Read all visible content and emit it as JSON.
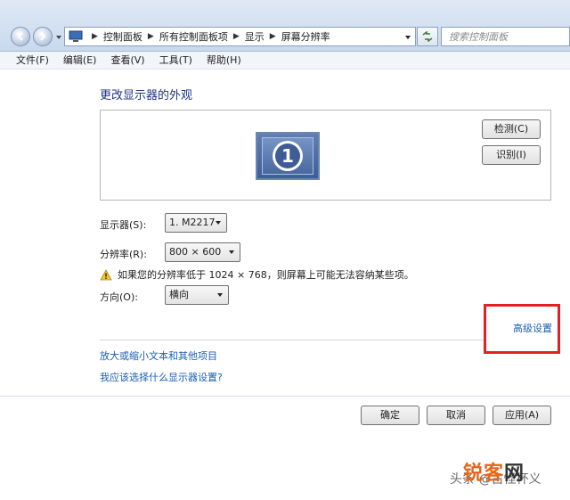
{
  "window": {
    "breadcrumbs": [
      "控制面板",
      "所有控制面板项",
      "显示",
      "屏幕分辨率"
    ],
    "search_placeholder": "搜索控制面板"
  },
  "menu": [
    "文件(F)",
    "编辑(E)",
    "查看(V)",
    "工具(T)",
    "帮助(H)"
  ],
  "main": {
    "title": "更改显示器的外观",
    "monitor_number": "1",
    "detect_label": "检测(C)",
    "identify_label": "识别(I)",
    "display_label": "显示器(S):",
    "display_value": "1. M2217",
    "resolution_label": "分辨率(R):",
    "resolution_value": "800 × 600",
    "warning_text": "如果您的分辨率低于 1024 × 768，则屏幕上可能无法容纳某些项。",
    "orientation_label": "方向(O):",
    "orientation_value": "横向",
    "advanced_link": "高级设置",
    "link_enlarge": "放大或缩小文本和其他项目",
    "link_help": "我应该选择什么显示器设置?"
  },
  "footer": {
    "ok_label": "确定",
    "cancel_label": "取消",
    "apply_label": "应用(A)"
  },
  "watermark": {
    "toutiao": "头条 @古怪杯义",
    "logo_part1": "锐客",
    "logo_part2": "网"
  },
  "colors": {
    "link": "#1a5fb4",
    "title": "#1e3287",
    "highlight": "#e52025",
    "watermark_logo": "#e5661b"
  },
  "icons": [
    "back-arrow-icon",
    "forward-arrow-icon",
    "control-panel-icon",
    "refresh-icon",
    "warning-icon",
    "monitor-icon"
  ]
}
